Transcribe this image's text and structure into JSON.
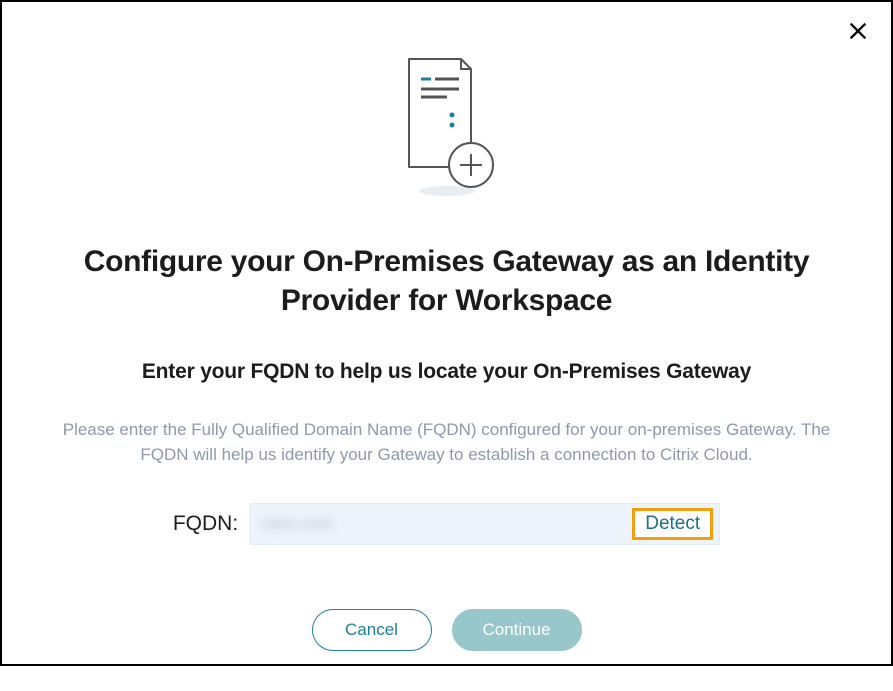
{
  "dialog": {
    "heading": "Configure your On-Premises Gateway as an Identity Provider for Workspace",
    "subheading": "Enter your FQDN to help us locate your On-Premises Gateway",
    "description": "Please enter the Fully Qualified Domain Name (FQDN) configured for your on-premises Gateway. The FQDN will help us identify your Gateway to establish a connection to Citrix Cloud.",
    "fqdn_label": "FQDN:",
    "fqdn_value": "citrix.com",
    "detect_label": "Detect",
    "cancel_label": "Cancel",
    "continue_label": "Continue"
  },
  "colors": {
    "accent": "#1f7e9a",
    "muted_text": "#8e99ab",
    "field_bg": "#edf3fa",
    "continue_bg": "#97c6cb",
    "highlight_border": "#f59e0b"
  }
}
